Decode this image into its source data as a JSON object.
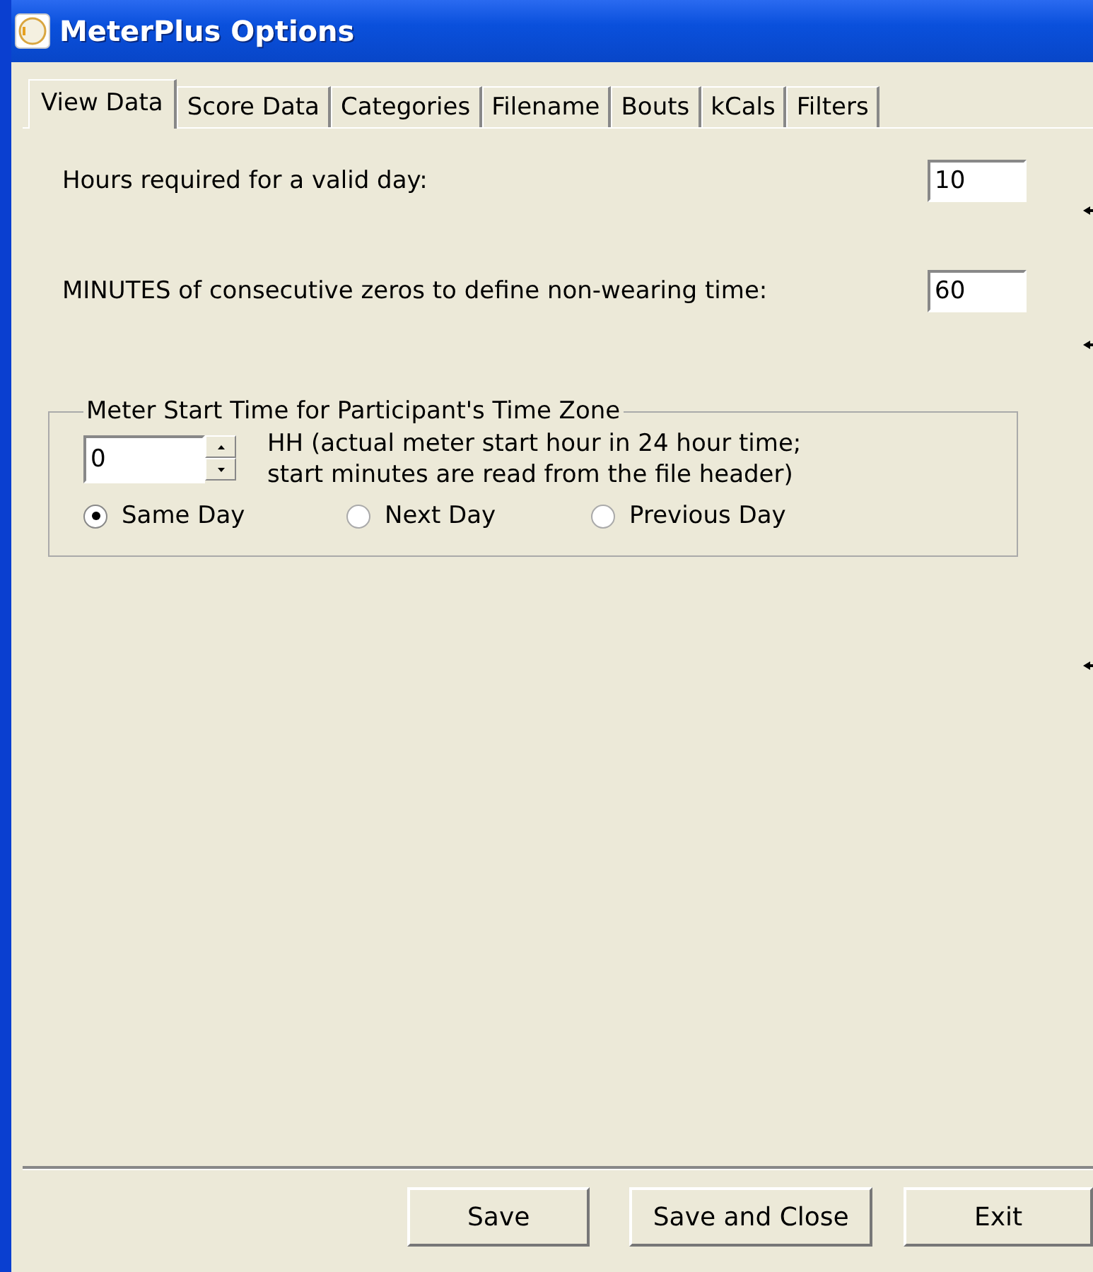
{
  "window": {
    "title": "MeterPlus Options"
  },
  "tabs": [
    {
      "label": "View Data",
      "selected": true
    },
    {
      "label": "Score Data",
      "selected": false
    },
    {
      "label": "Categories",
      "selected": false
    },
    {
      "label": "Filename",
      "selected": false
    },
    {
      "label": "Bouts",
      "selected": false
    },
    {
      "label": "kCals",
      "selected": false
    },
    {
      "label": "Filters",
      "selected": false
    }
  ],
  "fields": [
    {
      "label": "Hours required for a valid day:",
      "value": "10"
    },
    {
      "label": "MINUTES of consecutive zeros to define non-wearing time:",
      "value": "60"
    }
  ],
  "start_time_group": {
    "title": "Meter Start Time for Participant's Time Zone",
    "hour_value": "0",
    "hint_lines": [
      "HH (actual meter start hour in 24 hour time;",
      "start minutes are read from the file header)"
    ],
    "options": [
      {
        "label": "Same Day",
        "selected": true
      },
      {
        "label": "Next Day",
        "selected": false
      },
      {
        "label": "Previous Day",
        "selected": false
      }
    ]
  },
  "buttons": [
    "Save",
    "Save and Close",
    "Exit"
  ]
}
